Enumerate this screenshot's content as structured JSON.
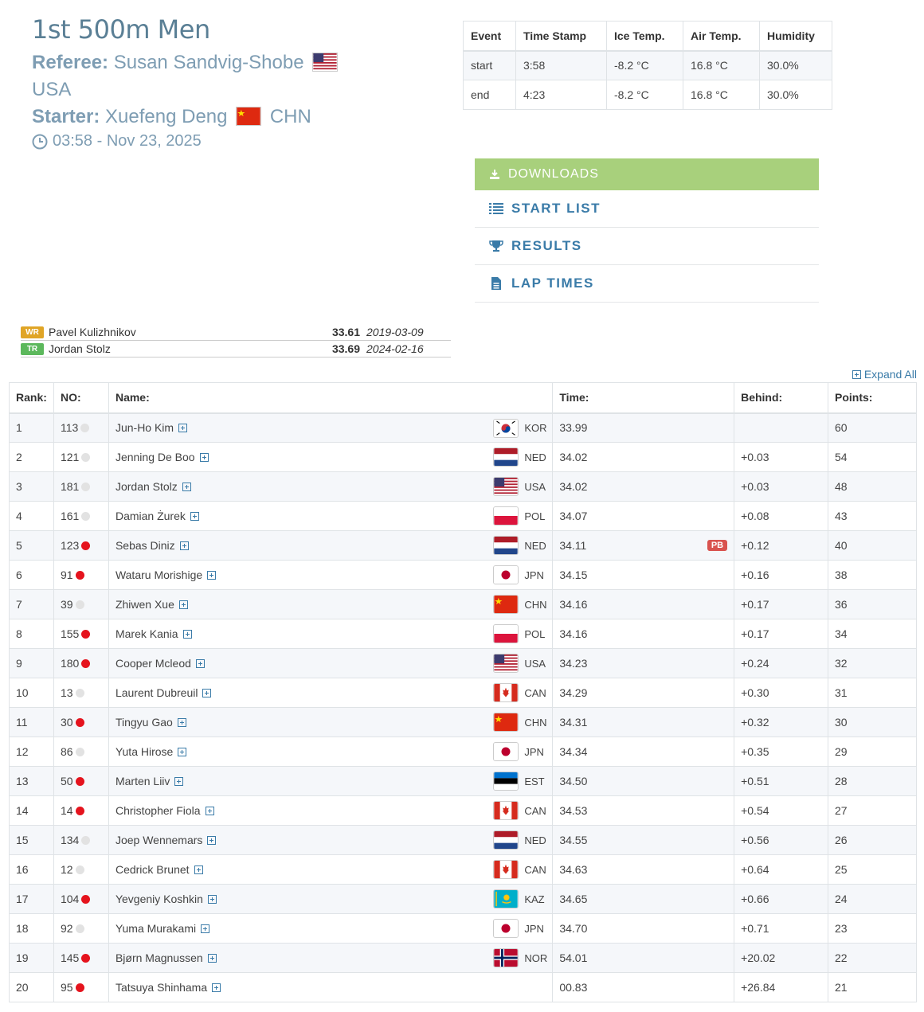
{
  "event": {
    "title": "1st 500m Men",
    "referee_label": "Referee:",
    "referee_name": "Susan Sandvig-Shobe",
    "referee_country": "USA",
    "starter_label": "Starter:",
    "starter_name": "Xuefeng Deng",
    "starter_country": "CHN",
    "datetime": "03:58 - Nov 23, 2025"
  },
  "conditions": {
    "headers": [
      "Event",
      "Time Stamp",
      "Ice Temp.",
      "Air Temp.",
      "Humidity"
    ],
    "rows": [
      [
        "start",
        "3:58",
        "-8.2 °C",
        "16.8 °C",
        "30.0%"
      ],
      [
        "end",
        "4:23",
        "-8.2 °C",
        "16.8 °C",
        "30.0%"
      ]
    ]
  },
  "menu": {
    "downloads": "DOWNLOADS",
    "start_list": "START LIST",
    "results": "RESULTS",
    "lap_times": "LAP TIMES"
  },
  "records": [
    {
      "badge": "WR",
      "color": "#e0a526",
      "name": "Pavel Kulizhnikov",
      "time": "33.61",
      "date": "2019-03-09"
    },
    {
      "badge": "TR",
      "color": "#5cb85c",
      "name": "Jordan Stolz",
      "time": "33.69",
      "date": "2024-02-16"
    }
  ],
  "expand_all": "Expand All",
  "results": {
    "headers": [
      "Rank:",
      "NO:",
      "Name:",
      "Time:",
      "Behind:",
      "Points:"
    ],
    "rows": [
      {
        "rank": "1",
        "no": "113",
        "dot": "w",
        "name": "Jun-Ho Kim",
        "nat": "KOR",
        "time": "33.99",
        "pb": "",
        "behind": "",
        "points": "60"
      },
      {
        "rank": "2",
        "no": "121",
        "dot": "w",
        "name": "Jenning De Boo",
        "nat": "NED",
        "time": "34.02",
        "pb": "",
        "behind": "+0.03",
        "points": "54"
      },
      {
        "rank": "3",
        "no": "181",
        "dot": "w",
        "name": "Jordan Stolz",
        "nat": "USA",
        "time": "34.02",
        "pb": "",
        "behind": "+0.03",
        "points": "48"
      },
      {
        "rank": "4",
        "no": "161",
        "dot": "w",
        "name": "Damian Żurek",
        "nat": "POL",
        "time": "34.07",
        "pb": "",
        "behind": "+0.08",
        "points": "43"
      },
      {
        "rank": "5",
        "no": "123",
        "dot": "r",
        "name": "Sebas Diniz",
        "nat": "NED",
        "time": "34.11",
        "pb": "PB",
        "behind": "+0.12",
        "points": "40"
      },
      {
        "rank": "6",
        "no": "91",
        "dot": "r",
        "name": "Wataru Morishige",
        "nat": "JPN",
        "time": "34.15",
        "pb": "",
        "behind": "+0.16",
        "points": "38"
      },
      {
        "rank": "7",
        "no": "39",
        "dot": "w",
        "name": "Zhiwen Xue",
        "nat": "CHN",
        "time": "34.16",
        "pb": "",
        "behind": "+0.17",
        "points": "36"
      },
      {
        "rank": "8",
        "no": "155",
        "dot": "r",
        "name": "Marek Kania",
        "nat": "POL",
        "time": "34.16",
        "pb": "",
        "behind": "+0.17",
        "points": "34"
      },
      {
        "rank": "9",
        "no": "180",
        "dot": "r",
        "name": "Cooper Mcleod",
        "nat": "USA",
        "time": "34.23",
        "pb": "",
        "behind": "+0.24",
        "points": "32"
      },
      {
        "rank": "10",
        "no": "13",
        "dot": "w",
        "name": "Laurent Dubreuil",
        "nat": "CAN",
        "time": "34.29",
        "pb": "",
        "behind": "+0.30",
        "points": "31"
      },
      {
        "rank": "11",
        "no": "30",
        "dot": "r",
        "name": "Tingyu Gao",
        "nat": "CHN",
        "time": "34.31",
        "pb": "",
        "behind": "+0.32",
        "points": "30"
      },
      {
        "rank": "12",
        "no": "86",
        "dot": "w",
        "name": "Yuta Hirose",
        "nat": "JPN",
        "time": "34.34",
        "pb": "",
        "behind": "+0.35",
        "points": "29"
      },
      {
        "rank": "13",
        "no": "50",
        "dot": "r",
        "name": "Marten Liiv",
        "nat": "EST",
        "time": "34.50",
        "pb": "",
        "behind": "+0.51",
        "points": "28"
      },
      {
        "rank": "14",
        "no": "14",
        "dot": "r",
        "name": "Christopher Fiola",
        "nat": "CAN",
        "time": "34.53",
        "pb": "",
        "behind": "+0.54",
        "points": "27"
      },
      {
        "rank": "15",
        "no": "134",
        "dot": "w",
        "name": "Joep Wennemars",
        "nat": "NED",
        "time": "34.55",
        "pb": "",
        "behind": "+0.56",
        "points": "26"
      },
      {
        "rank": "16",
        "no": "12",
        "dot": "w",
        "name": "Cedrick Brunet",
        "nat": "CAN",
        "time": "34.63",
        "pb": "",
        "behind": "+0.64",
        "points": "25"
      },
      {
        "rank": "17",
        "no": "104",
        "dot": "r",
        "name": "Yevgeniy Koshkin",
        "nat": "KAZ",
        "time": "34.65",
        "pb": "",
        "behind": "+0.66",
        "points": "24"
      },
      {
        "rank": "18",
        "no": "92",
        "dot": "w",
        "name": "Yuma Murakami",
        "nat": "JPN",
        "time": "34.70",
        "pb": "",
        "behind": "+0.71",
        "points": "23"
      },
      {
        "rank": "19",
        "no": "145",
        "dot": "r",
        "name": "Bjørn Magnussen",
        "nat": "NOR",
        "time": "54.01",
        "pb": "",
        "behind": "+20.02",
        "points": "22"
      },
      {
        "rank": "20",
        "no": "95",
        "dot": "r",
        "name": "Tatsuya Shinhama",
        "nat": "",
        "time": "00.83",
        "pb": "",
        "behind": "+26.84",
        "points": "21"
      }
    ]
  }
}
